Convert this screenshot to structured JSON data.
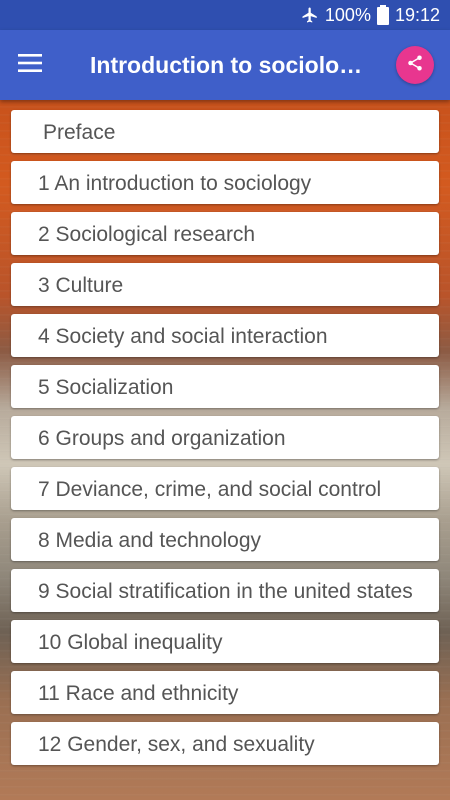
{
  "status_bar": {
    "battery": "100%",
    "time": "19:12",
    "icons": [
      "airplane-icon",
      "battery-icon"
    ]
  },
  "app_bar": {
    "title": "Introduction to sociolo…",
    "menu_icon": "hamburger-menu-icon",
    "share_icon": "share-icon",
    "colors": {
      "app_bar": "#3f5fc9",
      "status_bar": "#2f4fb0",
      "share_button": "#e8368f"
    }
  },
  "chapters": [
    "Preface",
    "1 An introduction to sociology",
    "2 Sociological research",
    "3 Culture",
    "4 Society and social interaction",
    "5 Socialization",
    "6 Groups and organization",
    "7 Deviance, crime, and social control",
    "8 Media and technology",
    "9 Social stratification in the united states",
    "10 Global inequality",
    "11 Race and ethnicity",
    "12 Gender, sex, and sexuality"
  ]
}
